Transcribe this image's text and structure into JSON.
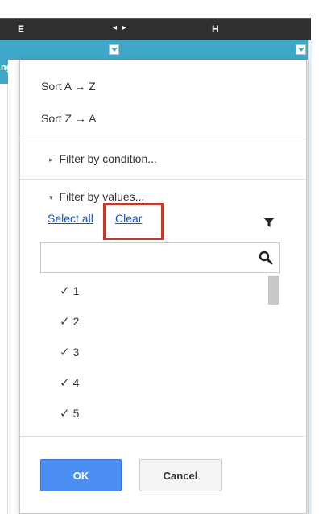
{
  "spreadsheet": {
    "column_left_letter": "E",
    "column_right_letter": "H",
    "column_nav_arrows": "◂ ▸",
    "left_cell_fragment": "ng"
  },
  "menu": {
    "sort_a_z": "Sort A → Z",
    "sort_z_a": "Sort Z → A",
    "filter_by_condition": "Filter by condition...",
    "filter_by_values": "Filter by values...",
    "select_all": "Select all",
    "clear": "Clear",
    "values": [
      {
        "label": "1",
        "checked": true
      },
      {
        "label": "2",
        "checked": true
      },
      {
        "label": "3",
        "checked": true
      },
      {
        "label": "4",
        "checked": true
      },
      {
        "label": "5",
        "checked": true
      }
    ],
    "ok_label": "OK",
    "cancel_label": "Cancel",
    "check_glyph": "✓",
    "caret_collapsed": "▸",
    "caret_expanded": "▾"
  },
  "icons": {
    "filter_funnel": "funnel-icon",
    "search": "search-icon",
    "column_filter_dropdown": "dropdown-icon"
  },
  "colors": {
    "header_dark": "#2f2f2f",
    "filter_row": "#3fa7c9",
    "ok_button": "#4b8ef1",
    "link": "#1155cc",
    "highlight_box": "#c0392b"
  }
}
